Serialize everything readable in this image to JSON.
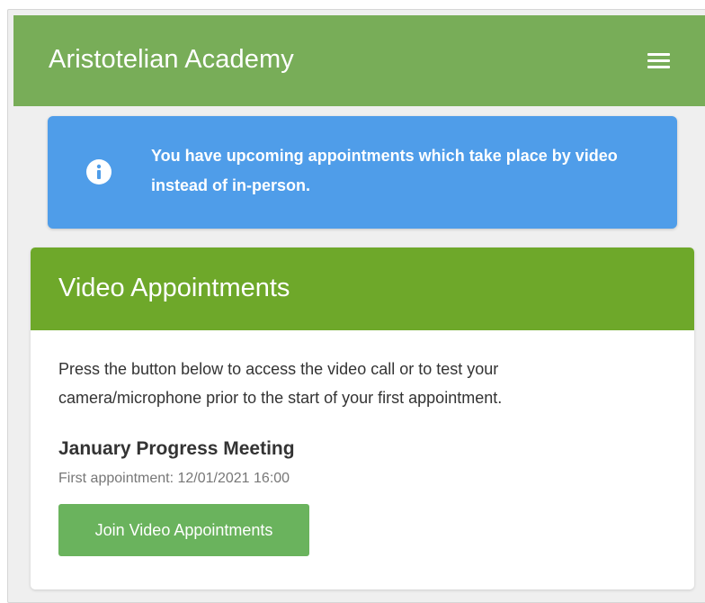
{
  "header": {
    "title": "Aristotelian Academy",
    "menu_icon": "hamburger-menu-icon"
  },
  "alert": {
    "icon": "info-icon",
    "message": "You have upcoming appointments which take place by video instead of in-person."
  },
  "card": {
    "title": "Video Appointments",
    "description": "Press the button below to access the video call or to test your camera/microphone prior to the start of your first appointment.",
    "meeting_title": "January Progress Meeting",
    "first_appointment": "First appointment: 12/01/2021 16:00",
    "join_label": "Join Video Appointments"
  },
  "colors": {
    "appbar": "#78ad58",
    "alert": "#4f9de9",
    "card_header": "#6ea82a",
    "button": "#6ab35d"
  }
}
